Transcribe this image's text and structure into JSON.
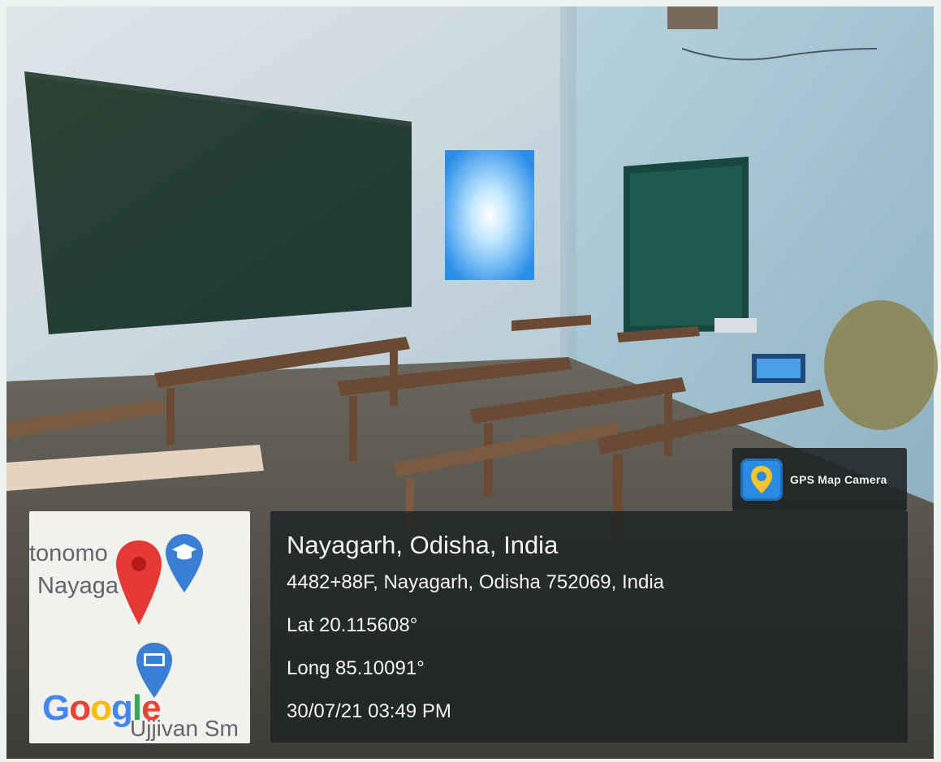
{
  "badge": {
    "app_name": "GPS Map Camera",
    "icon": "map-pin-app-icon"
  },
  "map": {
    "road_label_line1": "tonomo",
    "road_label_line2": "Nayaga",
    "poi_label": "Ujjivan Sm",
    "google_letters": [
      "G",
      "o",
      "o",
      "g",
      "l",
      "e"
    ],
    "google_colors": [
      "#4285f4",
      "#ea4335",
      "#fbbc05",
      "#4285f4",
      "#34a853",
      "#ea4335"
    ],
    "pins": [
      "red-location-pin-icon",
      "graduation-cap-pin-icon",
      "bank-pin-icon"
    ],
    "pin_colors": {
      "red": "#e53935",
      "blue": "#3b7fd4"
    }
  },
  "location": {
    "title": "Nayagarh, Odisha, India",
    "address": "4482+88F, Nayagarh, Odisha 752069, India",
    "lat": "Lat 20.115608°",
    "long": "Long 85.10091°",
    "datetime": "30/07/21 03:49 PM"
  }
}
